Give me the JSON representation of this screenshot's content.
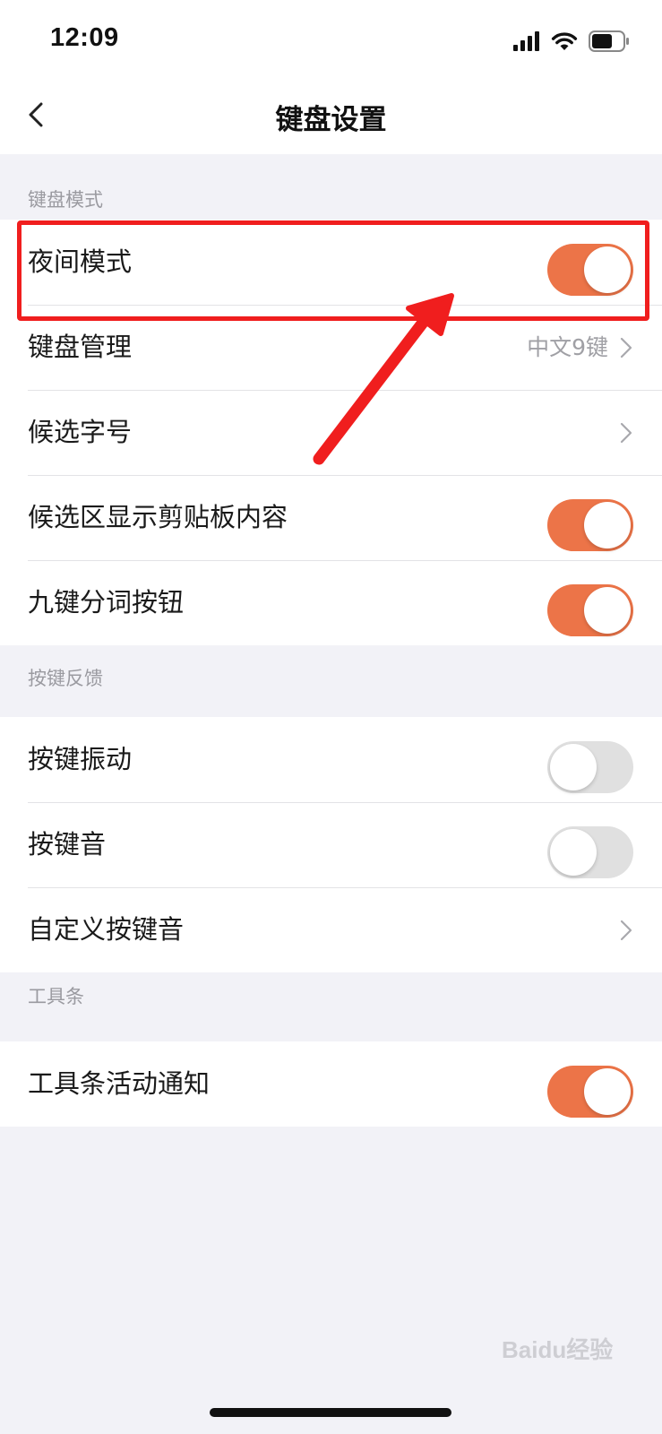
{
  "status_bar": {
    "time": "12:09",
    "icons": [
      "cellular-signal-icon",
      "wifi-icon",
      "battery-icon"
    ]
  },
  "nav": {
    "title": "键盘设置",
    "back_icon": "chevron-left-icon"
  },
  "sections": {
    "keyboard_mode": {
      "header": "键盘模式",
      "rows": {
        "night_mode": {
          "label": "夜间模式",
          "toggle_on": true
        },
        "keyboard_manage": {
          "label": "键盘管理",
          "value": "中文9键"
        },
        "candidate_font_size": {
          "label": "候选字号"
        },
        "clipboard_in_candidates": {
          "label": "候选区显示剪贴板内容",
          "toggle_on": true
        },
        "nine_key_segmentation": {
          "label": "九键分词按钮",
          "toggle_on": true
        }
      }
    },
    "key_feedback": {
      "header": "按键反馈",
      "rows": {
        "key_vibration": {
          "label": "按键振动",
          "toggle_on": false
        },
        "key_sound": {
          "label": "按键音",
          "toggle_on": false
        },
        "custom_key_sound": {
          "label": "自定义按键音"
        }
      }
    },
    "toolbar": {
      "header": "工具条",
      "rows": {
        "toolbar_notifications": {
          "label": "工具条活动通知",
          "toggle_on": true
        }
      }
    }
  },
  "colors": {
    "toggle_on": "#ec7448",
    "toggle_off": "#e0e0e0",
    "annotation_red": "#f01e1e",
    "background": "#f2f2f7"
  },
  "watermark": "Baidu经验"
}
